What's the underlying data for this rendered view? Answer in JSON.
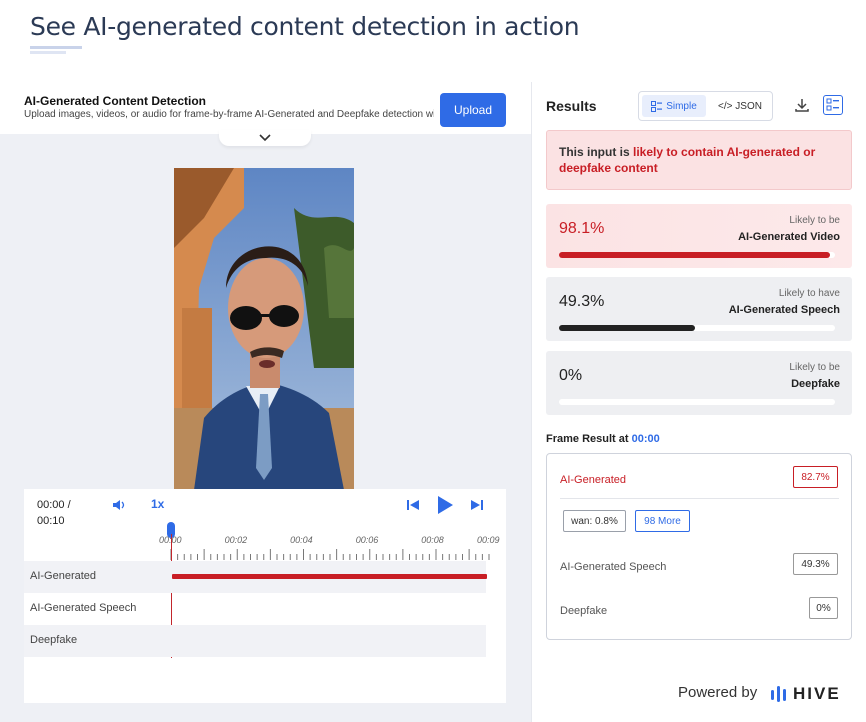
{
  "page": {
    "title": "See AI-generated content detection in action"
  },
  "demo": {
    "title": "AI-Generated Content Detection",
    "subtitle": "Upload images, videos, or audio for frame-by-frame AI-Generated and Deepfake detection with...",
    "upload_label": "Upload"
  },
  "player": {
    "time_current": "00:00 /",
    "time_total": "00:10",
    "speed": "1x",
    "ticks": [
      "00:00",
      "00:02",
      "00:04",
      "00:06",
      "00:08",
      "00:09"
    ],
    "playhead_fraction": 0.0,
    "tracks": [
      {
        "label": "AI-Generated",
        "has_bar": true
      },
      {
        "label": "AI-Generated Speech",
        "has_bar": false
      },
      {
        "label": "Deepfake",
        "has_bar": false
      }
    ]
  },
  "results": {
    "title": "Results",
    "toggle_simple": "Simple",
    "toggle_json": "</> JSON",
    "alert_prefix": "This input is ",
    "alert_highlight": "likely to contain AI-generated or deepfake content",
    "cards": [
      {
        "pct": "98.1%",
        "value": 0.981,
        "like": "Likely to be",
        "cls": "AI-Generated Video"
      },
      {
        "pct": "49.3%",
        "value": 0.493,
        "like": "Likely to have",
        "cls": "AI-Generated Speech"
      },
      {
        "pct": "0%",
        "value": 0.0,
        "like": "Likely to be",
        "cls": "Deepfake"
      }
    ],
    "frame_label": "Frame Result at ",
    "frame_time": "00:00",
    "frame": {
      "ai_label": "AI-Generated",
      "ai_value": "82.7%",
      "chip_wan": "wan: 0.8%",
      "chip_more": "98 More",
      "speech_label": "AI-Generated Speech",
      "speech_value": "49.3%",
      "deepfake_label": "Deepfake",
      "deepfake_value": "0%"
    },
    "powered_by": "Powered by",
    "brand": "HIVE"
  },
  "colors": {
    "accent": "#2f6be6",
    "danger": "#c81e25"
  },
  "icons": [
    "volume-icon",
    "skip-back-icon",
    "play-icon",
    "skip-forward-icon",
    "download-icon",
    "simple-view-icon",
    "chevron-down-icon",
    "hive-logo-icon"
  ]
}
